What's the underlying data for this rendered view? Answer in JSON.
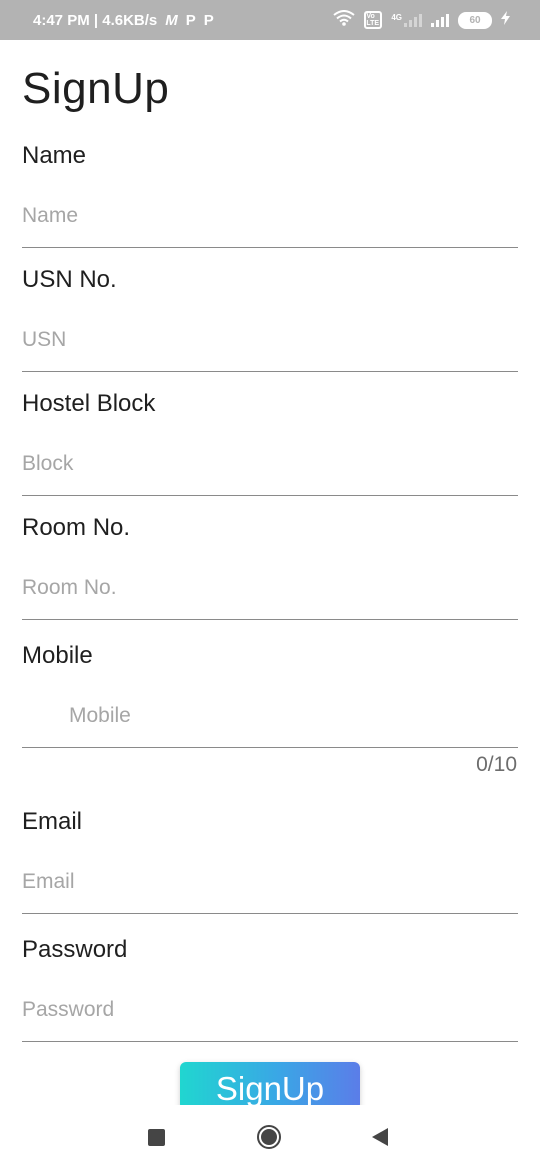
{
  "status_bar": {
    "time_speed": "4:47 PM | 4.6KB/s",
    "app_icons": [
      "M",
      "P",
      "P"
    ],
    "volte_label": "Vo LTE",
    "network_label": "4G",
    "battery_level": "60"
  },
  "page": {
    "title": "SignUp"
  },
  "form": {
    "name": {
      "label": "Name",
      "placeholder": "Name",
      "value": ""
    },
    "usn": {
      "label": "USN No.",
      "placeholder": "USN",
      "value": ""
    },
    "hostel_block": {
      "label": "Hostel Block",
      "placeholder": "Block",
      "value": ""
    },
    "room": {
      "label": "Room No.",
      "placeholder": "Room No.",
      "value": ""
    },
    "mobile": {
      "label": "Mobile",
      "placeholder": "Mobile",
      "value": "",
      "counter": "0/10"
    },
    "email": {
      "label": "Email",
      "placeholder": "Email",
      "value": ""
    },
    "password": {
      "label": "Password",
      "placeholder": "Password",
      "value": ""
    },
    "submit_label": "SignUp"
  },
  "icons": {
    "nav_recent": "square-recent-apps-icon",
    "nav_home": "circle-home-icon",
    "nav_back": "triangle-back-icon"
  },
  "colors": {
    "status_bar_bg": "#b3b3b3",
    "button_gradient_start": "#20d6d0",
    "button_gradient_end": "#5b7de8",
    "divider": "#8a8a8a",
    "placeholder": "#a6a6a6"
  }
}
